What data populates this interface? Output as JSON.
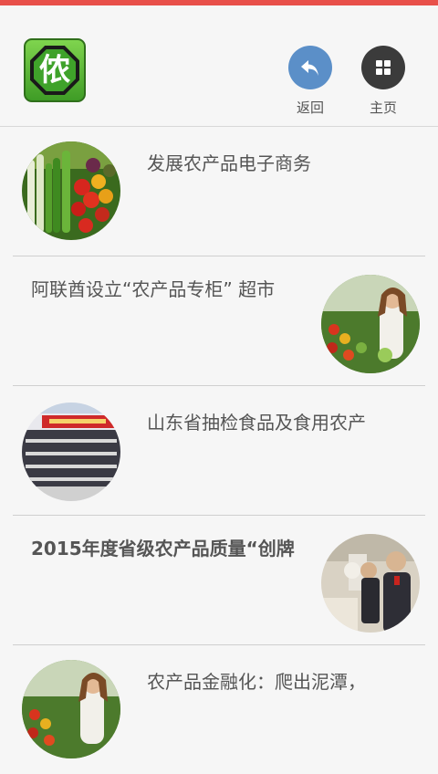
{
  "header": {
    "logo_text": "侬",
    "back_label": "返回",
    "home_label": "主页"
  },
  "colors": {
    "top_accent": "#e8504a",
    "back_button": "#5b8fc8",
    "home_button": "#3b3b3b",
    "logo_green": "#3fa22a"
  },
  "articles": [
    {
      "title": "发展农产品电子商务",
      "image": "vegetables-photo"
    },
    {
      "title": "阿联酋设立“农产品专柜” 超市",
      "image": "market-woman-photo"
    },
    {
      "title": "山东省抽检食品及食用农产",
      "image": "conference-hall-photo"
    },
    {
      "title": "2015年度省级农产品质量“创牌",
      "image": "officials-visit-photo"
    },
    {
      "title": "农产品金融化：爬出泥潭，",
      "image": "market-woman-photo"
    }
  ]
}
